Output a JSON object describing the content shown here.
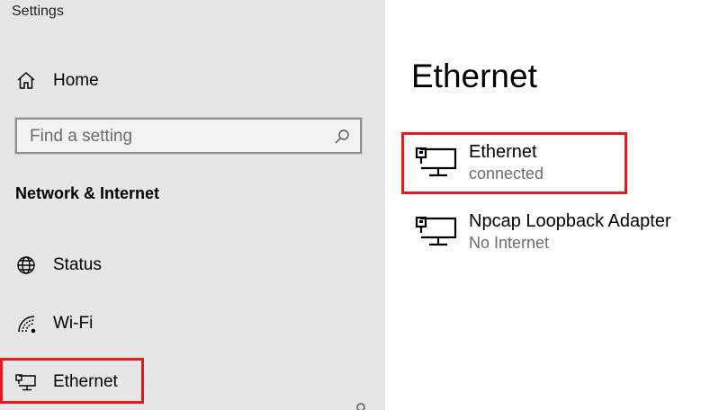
{
  "app": {
    "title": "Settings"
  },
  "sidebar": {
    "home_label": "Home",
    "search": {
      "placeholder": "Find a setting",
      "value": ""
    },
    "section_heading": "Network & Internet",
    "items": [
      {
        "label": "Status",
        "icon": "globe-icon"
      },
      {
        "label": "Wi-Fi",
        "icon": "wifi-icon"
      },
      {
        "label": "Ethernet",
        "icon": "ethernet-icon",
        "selected": true
      }
    ]
  },
  "main": {
    "title": "Ethernet",
    "adapters": [
      {
        "name": "Ethernet",
        "status": "connected",
        "icon": "ethernet-monitor-icon",
        "highlighted": true
      },
      {
        "name": "Npcap Loopback Adapter",
        "status": "No Internet",
        "icon": "ethernet-monitor-icon"
      }
    ]
  },
  "colors": {
    "highlight": "#e8191c",
    "sidebar_bg": "#e6e6e6",
    "status_text": "#6d6d6d"
  }
}
